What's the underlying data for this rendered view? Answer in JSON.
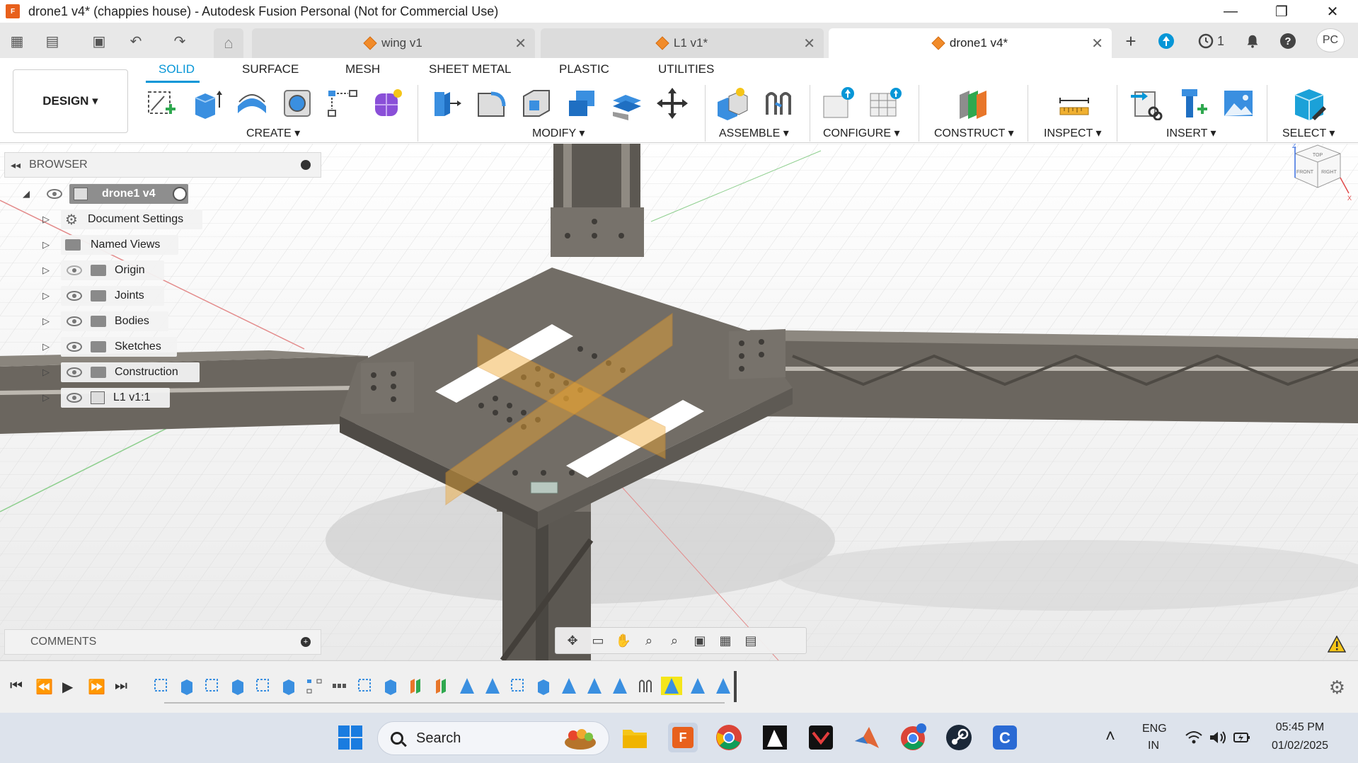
{
  "window": {
    "title": "drone1 v4* (chappies house) - Autodesk Fusion Personal (Not for Commercial Use)",
    "app_logo": "F",
    "minimize": "—",
    "restore": "❐",
    "close": "✕"
  },
  "tabs": [
    {
      "label": "wing v1",
      "close": "✕"
    },
    {
      "label": "L1 v1*",
      "close": "✕"
    },
    {
      "label": "drone1 v4*",
      "close": "✕"
    }
  ],
  "tabbar": {
    "new_tab": "+",
    "job_count": "1",
    "user_initials": "PC"
  },
  "ribbon": {
    "workspace": "DESIGN ▾",
    "tabs": [
      "SOLID",
      "SURFACE",
      "MESH",
      "SHEET METAL",
      "PLASTIC",
      "UTILITIES"
    ],
    "groups": [
      "CREATE ▾",
      "MODIFY ▾",
      "ASSEMBLE ▾",
      "CONFIGURE ▾",
      "CONSTRUCT ▾",
      "INSPECT ▾",
      "INSERT ▾",
      "SELECT ▾"
    ]
  },
  "browser": {
    "title": "BROWSER",
    "root": "drone1 v4",
    "items": [
      {
        "label": "Document Settings",
        "icon": "gear-icon"
      },
      {
        "label": "Named Views",
        "icon": "folder-icon"
      },
      {
        "label": "Origin",
        "icon": "folder-icon",
        "visible": false
      },
      {
        "label": "Joints",
        "icon": "folder-icon",
        "visible": true
      },
      {
        "label": "Bodies",
        "icon": "folder-icon",
        "visible": true
      },
      {
        "label": "Sketches",
        "icon": "folder-icon",
        "visible": true
      },
      {
        "label": "Construction",
        "icon": "folder-icon",
        "visible": true
      },
      {
        "label": "L1 v1:1",
        "icon": "component-icon",
        "visible": true
      }
    ]
  },
  "comments": {
    "title": "COMMENTS"
  },
  "viewcube": {
    "top": "TOP",
    "front": "FRONT",
    "right": "RIGHT",
    "z": "Z",
    "x": "X"
  },
  "taskbar": {
    "search": "Search",
    "lang1": "ENG",
    "lang2": "IN",
    "time": "05:45 PM",
    "date": "01/02/2025"
  },
  "colors": {
    "accent": "#0696d7",
    "model": "#66615a",
    "plane": "#f0a830"
  }
}
